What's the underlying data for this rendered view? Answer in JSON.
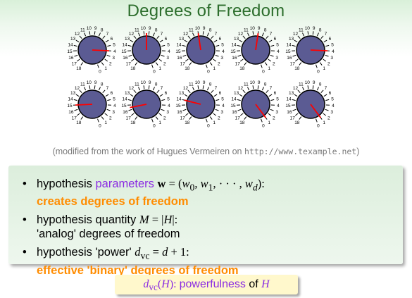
{
  "title": "Degrees of Freedom",
  "dial_labels": [
    "0",
    "1",
    "2",
    "3",
    "4",
    "5",
    "6",
    "7",
    "8",
    "9",
    "10",
    "11",
    "12",
    "13",
    "14",
    "15",
    "16",
    "17",
    "18"
  ],
  "dial_rows": [
    {
      "pointer_steps": [
        4,
        9.5,
        10,
        9,
        4
      ]
    },
    {
      "pointer_steps": [
        15,
        15.5,
        14,
        1,
        1
      ]
    }
  ],
  "colors": {
    "title": "#2d6e2d",
    "dial_fill": "#5b5b93",
    "pointer": "#ff0000",
    "purple": "#8a2be2",
    "orange": "#ff8c00",
    "green": "#2d8a2d"
  },
  "caption": {
    "prefix": "(modified from the work of Hugues Vermeiren on",
    "url": "http://www.texample.net",
    "suffix": ")"
  },
  "bullets": {
    "b1_prefix": "hypothesis ",
    "b1_word": "parameters",
    "b1_bold_w": "w",
    "b1_eq": " = (",
    "b1_w0": "w",
    "b1_s0": "0",
    "b1_w1": "w",
    "b1_s1": "1",
    "b1_dots": ", · · · , ",
    "b1_wd": "w",
    "b1_sd": "d",
    "b1_end": "):",
    "b1_line2": "creates degrees of freedom",
    "b2_prefix": "hypothesis quantity ",
    "b2_M": "M",
    "b2_eq": " = |",
    "b2_H": "H",
    "b2_end": "|:",
    "b2_line2": "'analog' degrees of freedom",
    "b3_prefix": "hypothesis 'power' ",
    "b3_d": "d",
    "b3_vc": "vc",
    "b3_eq": " = ",
    "b3_d2": "d",
    "b3_plus": " + 1:",
    "b3_line2": "effective 'binary' degrees of freedom"
  },
  "bottom": {
    "d": "d",
    "vc": "vc",
    "open": "(",
    "H": "H",
    "close": "): ",
    "word": "powerfulness",
    "of": " of ",
    "H2": "H"
  }
}
